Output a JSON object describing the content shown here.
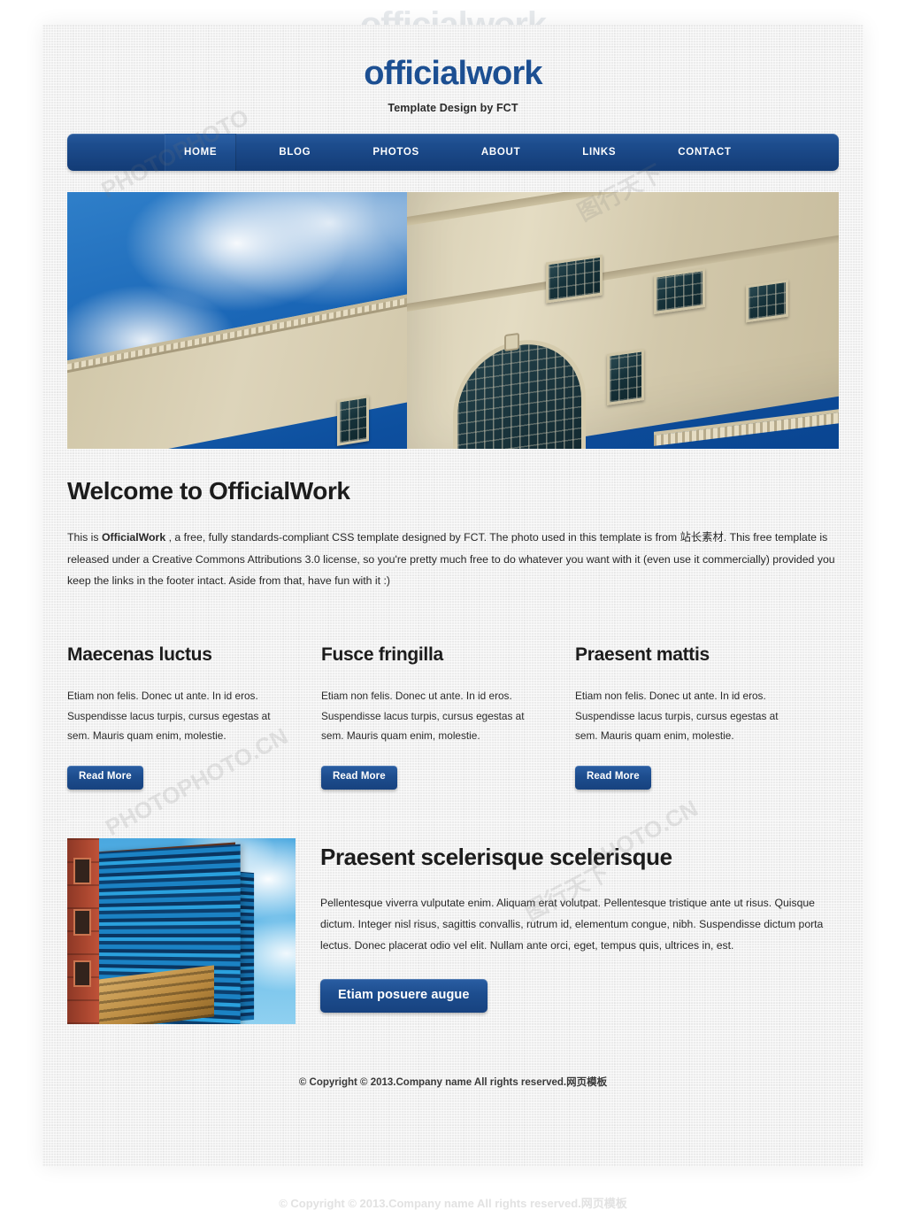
{
  "watermarks": {
    "top": "officialwork",
    "bottom": "© Copyright © 2013.Company name All rights reserved.网页模板",
    "stock": [
      "PHOTOPHOTO",
      "PHOTOPHOTO.CN",
      "图行天下",
      "PHOTO.CN",
      "图行天下"
    ]
  },
  "header": {
    "logo": "officialwork",
    "tagline": "Template Design by FCT"
  },
  "nav": {
    "items": [
      {
        "label": "HOME",
        "active": true
      },
      {
        "label": "BLOG",
        "active": false
      },
      {
        "label": "PHOTOS",
        "active": false
      },
      {
        "label": "ABOUT",
        "active": false
      },
      {
        "label": "LINKS",
        "active": false
      },
      {
        "label": "CONTACT",
        "active": false
      }
    ]
  },
  "hero": {
    "alt": "Classical stone government building against blue sky with clouds"
  },
  "welcome": {
    "heading": "Welcome to OfficialWork",
    "body_part1": "This is ",
    "body_bold": "OfficialWork",
    "body_part2": " , a free, fully standards-compliant CSS template designed by FCT. The photo used in this template is from 站长素材. This free template is released under a Creative Commons Attributions 3.0 license, so you're pretty much free to do whatever you want with it (even use it commercially) provided you keep the links in the footer intact. Aside from that, have fun with it :)"
  },
  "columns": [
    {
      "heading": "Maecenas luctus",
      "body": "Etiam non felis. Donec ut ante. In id eros. Suspendisse lacus turpis, cursus egestas at sem. Mauris quam enim, molestie.",
      "button": "Read More"
    },
    {
      "heading": "Fusce fringilla",
      "body": "Etiam non felis. Donec ut ante. In id eros. Suspendisse lacus turpis, cursus egestas at sem. Mauris quam enim, molestie.",
      "button": "Read More"
    },
    {
      "heading": "Praesent mattis",
      "body": "Etiam non felis. Donec ut ante. In id eros. Suspendisse lacus turpis, cursus egestas at sem. Mauris quam enim, molestie.",
      "button": "Read More"
    }
  ],
  "feature": {
    "image_alt": "Blue glass office tower beside a red brick building",
    "heading": "Praesent scelerisque scelerisque",
    "body": "Pellentesque viverra vulputate enim. Aliquam erat volutpat. Pellentesque tristique ante ut risus. Quisque dictum. Integer nisl risus, sagittis convallis, rutrum id, elementum congue, nibh. Suspendisse dictum porta lectus. Donec placerat odio vel elit. Nullam ante orci, eget, tempus quis, ultrices in, est.",
    "button": "Etiam posuere augue"
  },
  "footer": {
    "copyright": "© Copyright © 2013.Company name All rights reserved.网页模板"
  },
  "colors": {
    "brand_blue": "#1c4f92",
    "nav_blue": "#1d4d8e",
    "button_blue": "#1d4d8e",
    "page_bg": "#f2f2f2",
    "text": "#262626"
  }
}
